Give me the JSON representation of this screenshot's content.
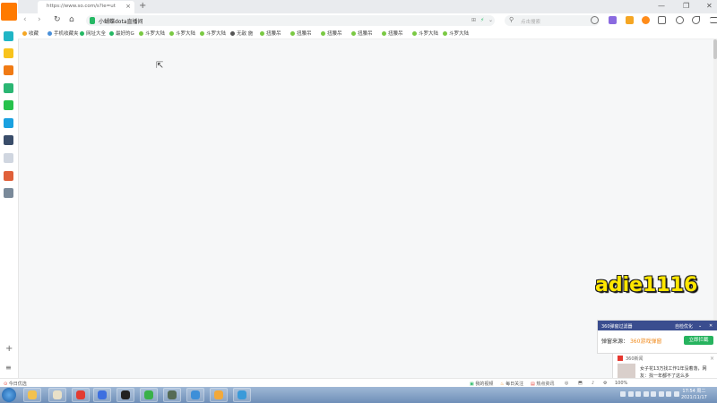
{
  "browser": {
    "tab_title": "https://www.so.com/s?ie=ut",
    "tab_close": "×",
    "new_tab": "+",
    "window_controls": [
      "—",
      "❐",
      "✕"
    ],
    "nav": {
      "back": "‹",
      "forward": "›",
      "refresh": "↻",
      "home": "⌂"
    },
    "address": {
      "url_text": "小蝴蝶dota直播间",
      "right_icons": [
        "⊞",
        "⚡",
        "⌄"
      ]
    },
    "search": {
      "icon": "search-icon",
      "placeholder": "点击搜索",
      "glyph": "⚲"
    },
    "toolbar_icons": [
      "scissors-icon",
      "dropdown-icon",
      "purple-app-icon",
      "dropdown-icon",
      "orange-app-icon",
      "game-icon",
      "grid-icon",
      "bell-icon",
      "undo-icon",
      "menu-icon"
    ]
  },
  "bookmarks": [
    {
      "label": "收藏",
      "color": "#f5a623"
    },
    {
      "label": "手机收藏夹",
      "color": "#4a90d9"
    },
    {
      "label": "网址大全",
      "color": "#25b864"
    },
    {
      "label": "最好的G",
      "color": "#25b864"
    },
    {
      "label": "斗罗大陆",
      "color": "#7ac943"
    },
    {
      "label": "斗罗大陆",
      "color": "#7ac943"
    },
    {
      "label": "斗罗大陆",
      "color": "#7ac943"
    },
    {
      "label": "无敌 施",
      "color": "#555555"
    },
    {
      "label": "扭腰吊",
      "color": "#7ac943"
    },
    {
      "label": "扭腰吊",
      "color": "#7ac943"
    },
    {
      "label": "扭腰吊",
      "color": "#7ac943"
    },
    {
      "label": "扭腰吊",
      "color": "#7ac943"
    },
    {
      "label": "扭腰吊",
      "color": "#7ac943"
    },
    {
      "label": "斗罗大陆",
      "color": "#7ac943"
    },
    {
      "label": "斗罗大陆",
      "color": "#7ac943"
    }
  ],
  "sidebar": {
    "items": [
      {
        "name": "sidebar-logo-icon",
        "color": "#ff7a00"
      },
      {
        "name": "sidebar-browser-icon",
        "color": "#20b5c5"
      },
      {
        "name": "sidebar-star-icon",
        "color": "#f8c31c"
      },
      {
        "name": "sidebar-weibo-icon",
        "color": "#f07a14"
      },
      {
        "name": "sidebar-mail-icon",
        "color": "#2bb673"
      },
      {
        "name": "sidebar-chat-icon",
        "color": "#27c24c"
      },
      {
        "name": "sidebar-p-icon",
        "color": "#1aa1e0"
      },
      {
        "name": "sidebar-calc-icon",
        "color": "#3a4d6a"
      },
      {
        "name": "sidebar-doc-icon",
        "color": "#d0d6e0"
      },
      {
        "name": "sidebar-app-icon",
        "color": "#e0603a"
      },
      {
        "name": "sidebar-photo-icon",
        "color": "#7a8a9a"
      }
    ],
    "add": "+",
    "more": "≡"
  },
  "watermark": "adie1116",
  "popup": {
    "title": "360弹窗过滤器",
    "link": "自检优化",
    "collapse": "⌄",
    "close": "✕",
    "message_prefix": "弹窗来源：",
    "message_highlight": "360游戏弹窗",
    "button": "立即拦截"
  },
  "news": {
    "source": "360新闻",
    "close": "×",
    "text": "女子花13万找工作1年没着落，网友：找一年都不了这么多"
  },
  "statusbar": {
    "left": "今日优选",
    "items": [
      "我的视频",
      "每日关注",
      "热点资讯"
    ],
    "zoom": "100%"
  },
  "taskbar": {
    "apps": [
      {
        "name": "taskbar-folder-icon",
        "color": "#f2c14e"
      },
      {
        "name": "taskbar-explorer-icon",
        "color": "#e8e0c8"
      },
      {
        "name": "taskbar-netease-music-icon",
        "color": "#e23b32"
      },
      {
        "name": "taskbar-feishu-icon",
        "color": "#3d6fe0"
      },
      {
        "name": "taskbar-obs-icon",
        "color": "#222222"
      },
      {
        "name": "taskbar-360-browser-icon",
        "color": "#3ab14a"
      },
      {
        "name": "taskbar-dota-icon",
        "color": "#556b55"
      },
      {
        "name": "taskbar-game-icon",
        "color": "#3d8fd8"
      },
      {
        "name": "taskbar-app-icon",
        "color": "#f2a93b"
      },
      {
        "name": "taskbar-ie-icon",
        "color": "#3a9ad9"
      }
    ],
    "clock_time": "17:54 周二",
    "clock_date": "2021/11/17"
  }
}
